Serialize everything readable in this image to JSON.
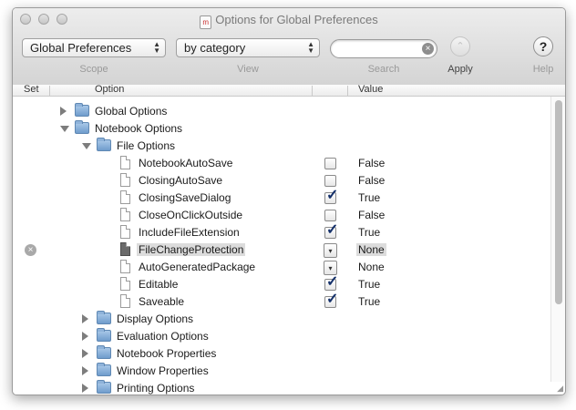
{
  "window": {
    "title": "Options for Global Preferences"
  },
  "toolbar": {
    "scope": {
      "value": "Global Preferences",
      "label": "Scope"
    },
    "view": {
      "value": "by category",
      "label": "View"
    },
    "search": {
      "label": "Search",
      "value": "",
      "placeholder": ""
    },
    "apply": {
      "label": "Apply"
    },
    "help": {
      "label": "Help",
      "glyph": "?"
    }
  },
  "columns": {
    "set": "Set",
    "option": "Option",
    "value": "Value"
  },
  "tree": [
    {
      "label": "Global Options",
      "kind": "folder",
      "expanded": false
    },
    {
      "label": "Notebook Options",
      "kind": "folder",
      "expanded": true
    },
    {
      "label": "File Options",
      "kind": "folder",
      "expanded": true
    },
    {
      "label": "NotebookAutoSave",
      "kind": "doc",
      "control": "checkbox",
      "checked": false,
      "value": "False"
    },
    {
      "label": "ClosingAutoSave",
      "kind": "doc",
      "control": "checkbox",
      "checked": false,
      "value": "False"
    },
    {
      "label": "ClosingSaveDialog",
      "kind": "doc",
      "control": "checkbox",
      "checked": true,
      "value": "True"
    },
    {
      "label": "CloseOnClickOutside",
      "kind": "doc",
      "control": "checkbox",
      "checked": false,
      "value": "False"
    },
    {
      "label": "IncludeFileExtension",
      "kind": "doc",
      "control": "checkbox",
      "checked": true,
      "value": "True"
    },
    {
      "label": "FileChangeProtection",
      "kind": "doc",
      "control": "popup",
      "value": "None",
      "selected": true,
      "set": true
    },
    {
      "label": "AutoGeneratedPackage",
      "kind": "doc",
      "control": "popup",
      "value": "None"
    },
    {
      "label": "Editable",
      "kind": "doc",
      "control": "checkbox",
      "checked": true,
      "value": "True"
    },
    {
      "label": "Saveable",
      "kind": "doc",
      "control": "checkbox",
      "checked": true,
      "value": "True"
    },
    {
      "label": "Display Options",
      "kind": "folder",
      "expanded": false
    },
    {
      "label": "Evaluation Options",
      "kind": "folder",
      "expanded": false
    },
    {
      "label": "Notebook Properties",
      "kind": "folder",
      "expanded": false
    },
    {
      "label": "Window Properties",
      "kind": "folder",
      "expanded": false
    },
    {
      "label": "Printing Options",
      "kind": "folder",
      "expanded": false
    }
  ],
  "colors": {
    "checkmark": "#14306a",
    "selection": "#dcdcdc",
    "folder": "#7fa8d3"
  }
}
